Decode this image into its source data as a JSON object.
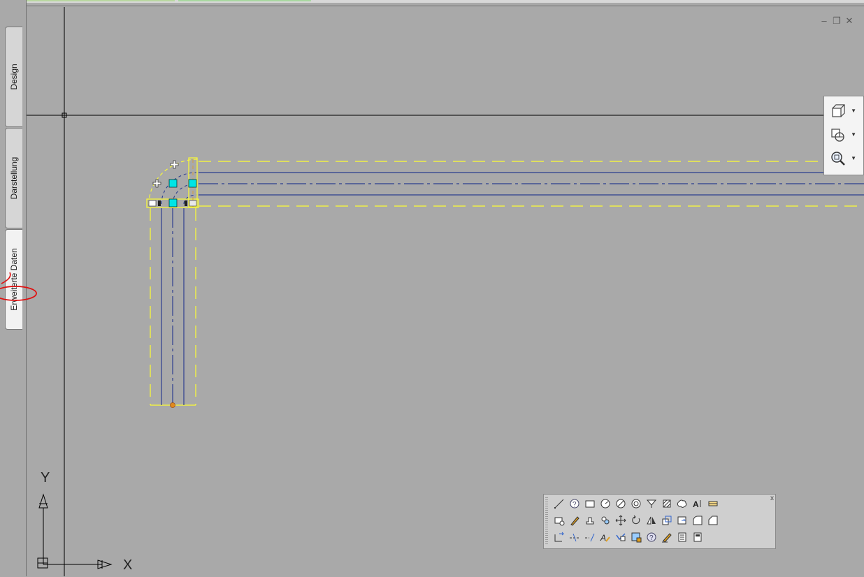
{
  "window": {
    "minimize_label": "–",
    "restore_label": "❐",
    "close_label": "✕"
  },
  "side_tabs": [
    {
      "label": "Design",
      "active": false
    },
    {
      "label": "Darstellung",
      "active": false
    },
    {
      "label": "Erweiterte Daten",
      "active": true
    }
  ],
  "ucs": {
    "x_label": "X",
    "y_label": "Y"
  },
  "navigation_bar": {
    "items": [
      {
        "icon": "view-cube-icon"
      },
      {
        "icon": "orbit-icon"
      },
      {
        "icon": "zoom-icon"
      }
    ]
  },
  "tool_palette": {
    "close_label": "x",
    "rows": [
      [
        "line-icon",
        "help-icon",
        "rectangle-icon",
        "circle-icon",
        "circle-cross-icon",
        "donut-icon",
        "insert-block-icon",
        "hatch-icon",
        "revision-cloud-icon",
        "text-icon",
        "dimension-icon"
      ],
      [
        "properties-icon",
        "match-brush-icon",
        "stamp-icon",
        "copy-icon",
        "move-icon",
        "rotate-icon",
        "mirror-icon",
        "scale-icon",
        "stretch-icon",
        "fillet-icon",
        "chamfer-icon"
      ],
      [
        "trim-icon",
        "extend-icon",
        "break-icon",
        "text-style-icon",
        "check-icon",
        "block-edit-icon",
        "help-round-icon",
        "pen-icon",
        "list-icon",
        "calculator-icon"
      ]
    ]
  },
  "colors": {
    "background": "#a9a9a9",
    "pipe_line": "#2c3e8f",
    "boundary": "#ffff33",
    "grip": "#00e5e5"
  }
}
